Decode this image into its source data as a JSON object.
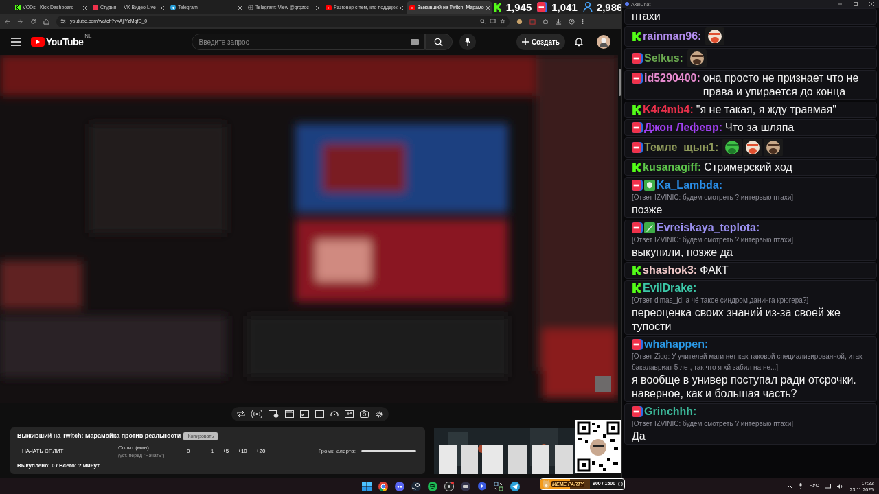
{
  "browser": {
    "tabs": [
      {
        "title": "VODs - Kick Dashboard",
        "kind": "kick",
        "selected": false
      },
      {
        "title": "Студия — VK Видео Live",
        "kind": "vk",
        "selected": false
      },
      {
        "title": "Telegram",
        "kind": "telegram",
        "selected": false
      },
      {
        "title": "Telegram: View @grgzdc",
        "kind": "globe",
        "selected": false
      },
      {
        "title": "Разговор с тем, кто поддерж",
        "kind": "youtube",
        "selected": false
      },
      {
        "title": "Выживший на Twitch: Марамо",
        "kind": "youtube",
        "selected": true
      }
    ],
    "url": "youtube.com/watch?v=AjjYzMqfD_0"
  },
  "stats": [
    {
      "kind": "kick",
      "value": "1,945"
    },
    {
      "kind": "vk",
      "value": "1,041"
    },
    {
      "kind": "viewers",
      "value": "2,986"
    }
  ],
  "youtube": {
    "logo": "YouTube",
    "region": "NL",
    "search_placeholder": "Введите запрос",
    "create_label": "Создать"
  },
  "widget": {
    "title": "Выживший на Twitch: Марамойка против реальности",
    "copy_button": "Копировать",
    "start_button": "НАЧАТЬ СПЛИТ",
    "split_label": "Сплит (мин):",
    "split_hint": "(уст. перед \"Начать\")",
    "split_value": "0",
    "increments": [
      "+1",
      "+5",
      "+10",
      "+20"
    ],
    "volume": {
      "label": "Громк. алерта:",
      "level": 1
    },
    "summary": "Выкуплено: 0 / Всего: ? минут"
  },
  "meme_party": {
    "label": "MEME PARTY",
    "progress": "900 / 1500",
    "level": 0.6
  },
  "chat": {
    "title": "AxelChat",
    "messages": [
      {
        "text": "птахи"
      },
      {
        "kind": "kick",
        "user": "rainman96:",
        "color": "#b48ef0"
      },
      {
        "kind": "vk",
        "user": "Selkus:",
        "color": "#6aa84f"
      },
      {
        "kind": "vk",
        "user": "id5290400:",
        "color": "#e88bd0",
        "text": "она просто не признает что не права и упирается до конца"
      },
      {
        "kind": "kick",
        "user": "K4r4mb4:",
        "color": "#e8304a",
        "text": "\"я не такая, я жду травмая\""
      },
      {
        "kind": "vk",
        "user": "Джон Лефевр:",
        "color": "#a040f0",
        "text": "Что за шляпа"
      },
      {
        "kind": "vk",
        "user": "Темле_щын1:",
        "color": "#8f9a5b"
      },
      {
        "kind": "kick",
        "user": "kusanagiff:",
        "color": "#5ec64b",
        "text": "Стримерский ход"
      },
      {
        "kind": "vk",
        "badges": [
          {
            "kind": "shield"
          }
        ],
        "user": "Ka_Lambda:",
        "color": "#2a8ee8",
        "reply": "[Ответ IZVINIC: будем смотреть ? интервью птахи]",
        "text": "позже"
      },
      {
        "kind": "vk",
        "badges": [
          {
            "kind": "sword"
          }
        ],
        "user": "Evreiskaya_teplota:",
        "color": "#9a8ff0",
        "reply": "[Ответ IZVINIC: будем смотреть ? интервью птахи]",
        "text": "выкупили, позже да"
      },
      {
        "kind": "kick",
        "user": "shashok3:",
        "color": "#f0c8c8",
        "text": "ФАКТ"
      },
      {
        "kind": "kick",
        "user": "EvilDrake:",
        "color": "#3cc8a8",
        "reply": "[Ответ dimas_jd: а чё такое синдром данинга крюгера?]",
        "text": "переоценка своих знаний из-за своей же тупости"
      },
      {
        "kind": "vk",
        "user": "whahappen:",
        "color": "#2a9ae8",
        "reply": "[Ответ Ziqq: У учителей маги нет как таковой специализированной, итак бакалавриат 5 лет, так что я хй забил на не...]",
        "text": "я вообще в универ поступал ради отсрочки. наверное, как и большая часть?"
      },
      {
        "kind": "vk",
        "user": "Grinchhh:",
        "color": "#3cb89a",
        "reply": "[Ответ IZVINIC: будем смотреть ? интервью птахи]",
        "text": "Да"
      }
    ]
  },
  "taskbar": {
    "language": "РУС",
    "time": "17:22",
    "date": "23.11.2025"
  }
}
